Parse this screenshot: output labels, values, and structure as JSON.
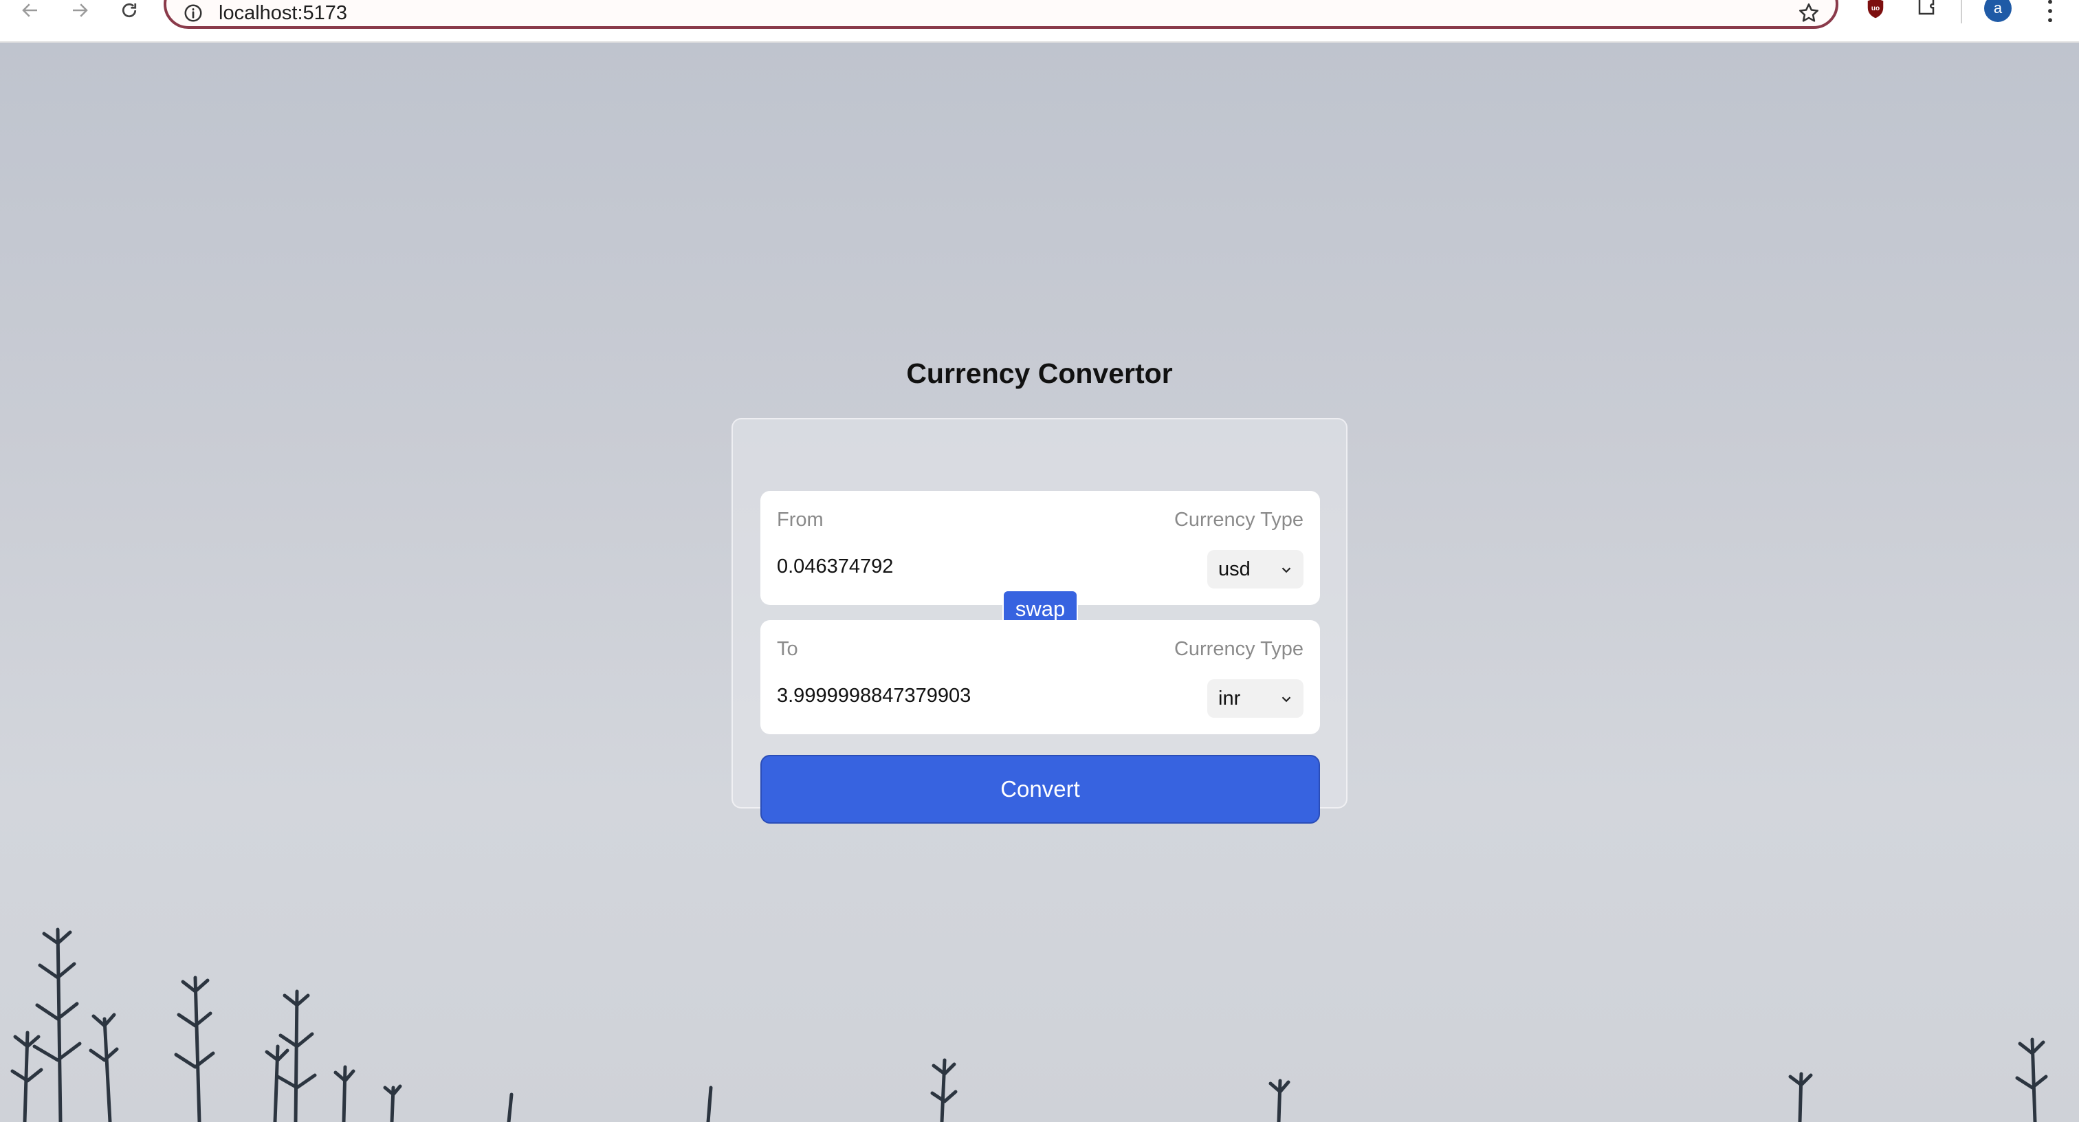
{
  "browser": {
    "url": "localhost:5173",
    "profile_initial": "a",
    "icons": [
      "back-icon",
      "forward-icon",
      "reload-icon",
      "site-info-icon",
      "bookmark-star-icon",
      "ublock-icon",
      "extensions-icon",
      "menu-dots-icon"
    ]
  },
  "app": {
    "title": "Currency Convertor",
    "from": {
      "label": "From",
      "type_label": "Currency Type",
      "amount": "0.046374792",
      "currency": "usd"
    },
    "swap_label": "swap",
    "to": {
      "label": "To",
      "type_label": "Currency Type",
      "amount": "3.9999998847379903",
      "currency": "inr"
    },
    "convert_label": "Convert"
  },
  "colors": {
    "accent": "#3763e0",
    "omnibox_border": "#8a3a4a",
    "avatar": "#1f5aa6"
  }
}
